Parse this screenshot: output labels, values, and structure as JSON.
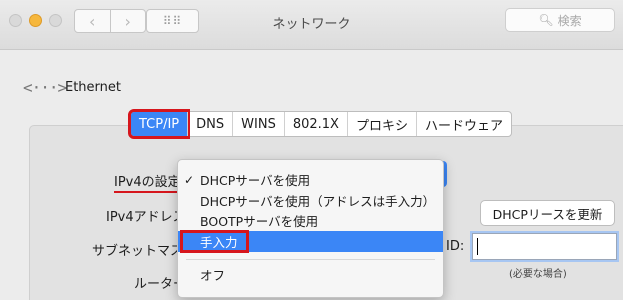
{
  "window": {
    "title": "ネットワーク",
    "search_placeholder": "検索",
    "grid_glyph": "⠿⠿"
  },
  "header": {
    "interface_name": "Ethernet"
  },
  "tabs": [
    {
      "label": "TCP/IP",
      "active": true
    },
    {
      "label": "DNS"
    },
    {
      "label": "WINS"
    },
    {
      "label": "802.1X"
    },
    {
      "label": "プロキシ"
    },
    {
      "label": "ハードウェア"
    }
  ],
  "form": {
    "ipv4_config_label": "IPv4の設定",
    "ipv4_address_label": "IPv4アドレス",
    "subnet_label": "サブネットマスク",
    "router_label": "ルーター"
  },
  "dropdown": {
    "items": [
      {
        "label": "DHCPサーバを使用",
        "checked": true
      },
      {
        "label": "DHCPサーバを使用（アドレスは手入力）"
      },
      {
        "label": "BOOTPサーバを使用"
      },
      {
        "label": "手入力",
        "highlighted": true
      },
      {
        "label": "オフ"
      }
    ],
    "check_glyph": "✓"
  },
  "dhcp": {
    "renew_button": "DHCPリースを更新",
    "client_id_label": "ID:",
    "client_id_value": "",
    "client_id_hint": "(必要な場合)"
  },
  "colors": {
    "accent": "#3b86f6",
    "annotation_red": "#d6161d",
    "minimize": "#f6b73c"
  }
}
